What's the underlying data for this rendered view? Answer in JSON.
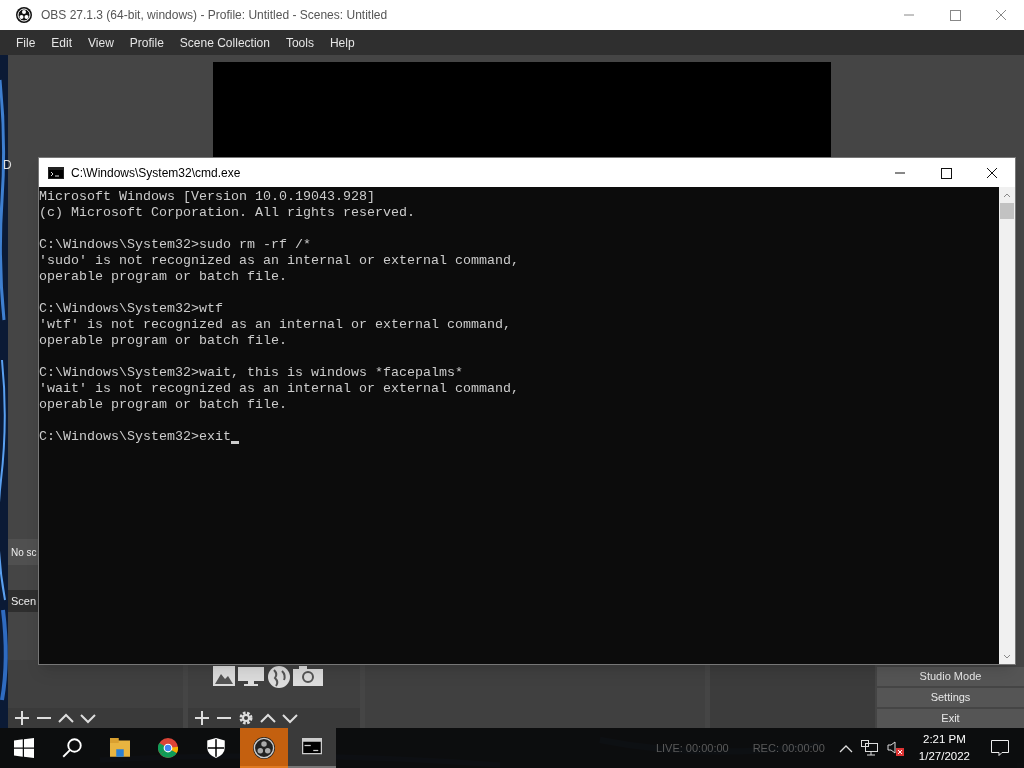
{
  "obs_window": {
    "title": "OBS 27.1.3 (64-bit, windows) - Profile: Untitled - Scenes: Untitled",
    "menu": [
      "File",
      "Edit",
      "View",
      "Profile",
      "Scene Collection",
      "Tools",
      "Help"
    ],
    "edge_text": "D",
    "scene_item": "No sc",
    "scenes_label": "Scen",
    "controls": [
      "Studio Mode",
      "Settings",
      "Exit"
    ]
  },
  "cmd_window": {
    "title": "C:\\Windows\\System32\\cmd.exe",
    "blocks": [
      [
        "Microsoft Windows [Version 10.0.19043.928]",
        "(c) Microsoft Corporation. All rights reserved."
      ],
      [
        "C:\\Windows\\System32>sudo rm -rf /*",
        "'sudo' is not recognized as an internal or external command,",
        "operable program or batch file."
      ],
      [
        "C:\\Windows\\System32>wtf",
        "'wtf' is not recognized as an internal or external command,",
        "operable program or batch file."
      ],
      [
        "C:\\Windows\\System32>wait, this is windows *facepalms*",
        "'wait' is not recognized as an internal or external command,",
        "operable program or batch file."
      ],
      [
        "C:\\Windows\\System32>exit"
      ]
    ]
  },
  "taskbar": {
    "apps": [
      {
        "kind": "start",
        "selected": false,
        "running": false
      },
      {
        "kind": "search",
        "selected": false,
        "running": false
      },
      {
        "kind": "explorer",
        "selected": false,
        "running": false
      },
      {
        "kind": "chrome",
        "selected": false,
        "running": false
      },
      {
        "kind": "security",
        "selected": false,
        "running": false
      },
      {
        "kind": "obs",
        "selected": true,
        "running": true
      },
      {
        "kind": "cmd",
        "selected": false,
        "running": true
      }
    ],
    "status": [
      "LIVE: 00:00:00",
      "REC: 00:00:00"
    ],
    "time": "2:21 PM",
    "date": "1/27/2022"
  }
}
